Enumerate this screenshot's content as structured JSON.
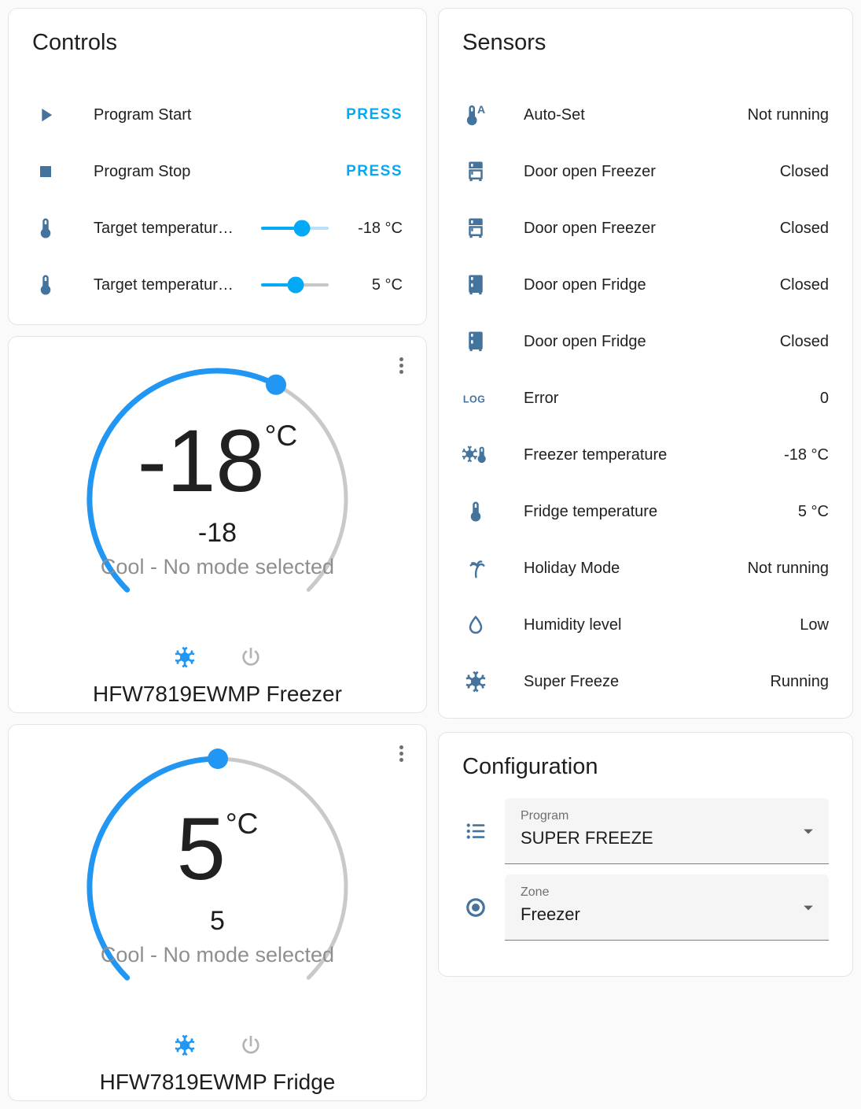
{
  "colors": {
    "accent_blue": "#03a9f4",
    "dial_blue": "#2196f3",
    "icon_steel": "#44739e",
    "inactive_power_gray": "#b3b3b3",
    "slider_inactive_blue": "#b9e1f9",
    "slider_inactive_gray": "#c7c7c7"
  },
  "controls": {
    "title": "Controls",
    "rows": [
      {
        "icon": "play",
        "label": "Program Start",
        "action": "PRESS"
      },
      {
        "icon": "stop",
        "label": "Program Stop",
        "action": "PRESS"
      },
      {
        "icon": "thermometer",
        "label": "Target temperatur…",
        "value": "-18 °C",
        "slider": {
          "fraction": 0.61,
          "inactive_color": "#b9e1f9"
        }
      },
      {
        "icon": "thermometer",
        "label": "Target temperatur…",
        "value": "5 °C",
        "slider": {
          "fraction": 0.51,
          "inactive_color": "#c7c7c7"
        }
      }
    ]
  },
  "freezer_card": {
    "temperature": "-18",
    "unit": "°C",
    "secondary_temperature": "-18",
    "mode_text": "Cool - No mode selected",
    "device_name": "HFW7819EWMP Freezer",
    "dial_fraction": 0.6,
    "modes": {
      "active": "cool",
      "inactive": "off"
    }
  },
  "fridge_card": {
    "temperature": "5",
    "unit": "°C",
    "secondary_temperature": "5",
    "mode_text": "Cool - No mode selected",
    "device_name": "HFW7819EWMP Fridge",
    "dial_fraction": 0.5,
    "modes": {
      "active": "cool",
      "inactive": "off"
    }
  },
  "sensors": {
    "title": "Sensors",
    "rows": [
      {
        "icon": "thermometer-auto",
        "label": "Auto-Set",
        "value": "Not running"
      },
      {
        "icon": "fridge-top",
        "label": "Door open Freezer",
        "value": "Closed"
      },
      {
        "icon": "fridge-top",
        "label": "Door open Freezer",
        "value": "Closed"
      },
      {
        "icon": "fridge-solid",
        "label": "Door open Fridge",
        "value": "Closed"
      },
      {
        "icon": "fridge-solid",
        "label": "Door open Fridge",
        "value": "Closed"
      },
      {
        "icon": "log",
        "label": "Error",
        "value": "0"
      },
      {
        "icon": "snowflake-thermometer",
        "label": "Freezer temperature",
        "value": "-18 °C"
      },
      {
        "icon": "thermometer",
        "label": "Fridge temperature",
        "value": "5 °C"
      },
      {
        "icon": "palm-tree",
        "label": "Holiday Mode",
        "value": "Not running"
      },
      {
        "icon": "water-drop",
        "label": "Humidity level",
        "value": "Low"
      },
      {
        "icon": "snowflake",
        "label": "Super Freeze",
        "value": "Running"
      }
    ]
  },
  "configuration": {
    "title": "Configuration",
    "fields": [
      {
        "icon": "list",
        "label": "Program",
        "value": "SUPER FREEZE"
      },
      {
        "icon": "radio",
        "label": "Zone",
        "value": "Freezer"
      }
    ]
  }
}
